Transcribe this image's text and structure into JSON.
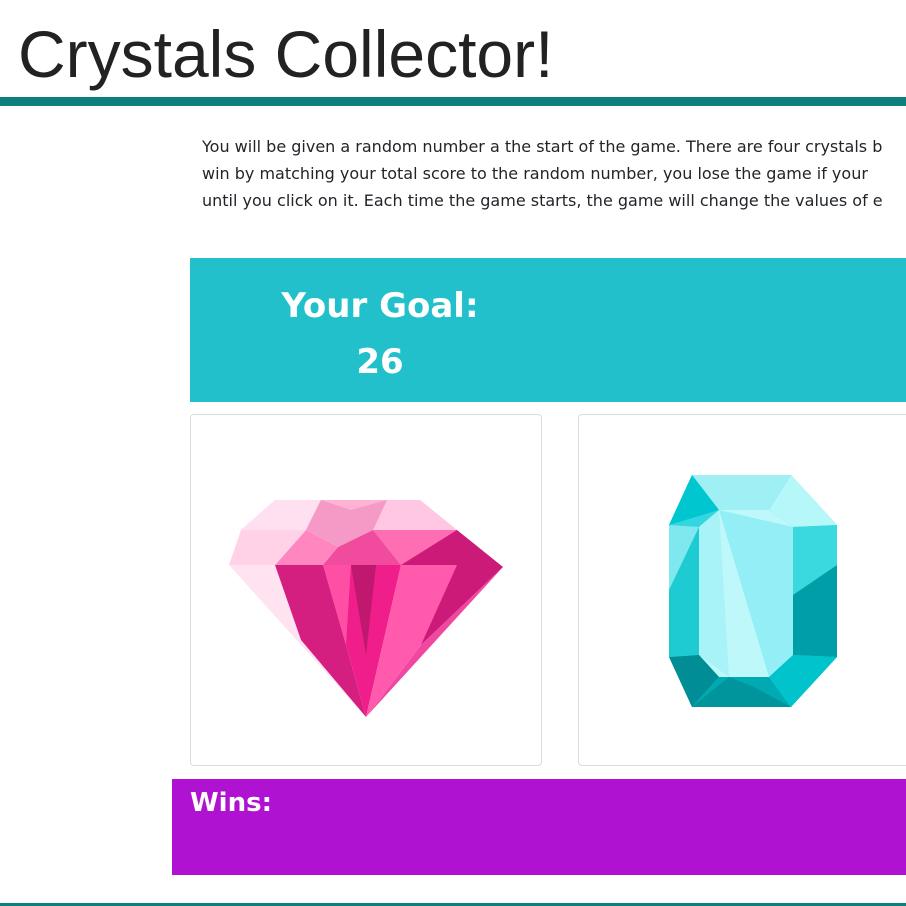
{
  "app": {
    "title": "Crystals Collector!"
  },
  "instructions": {
    "lines": [
      "You will be given a random number a the start of the game. There are four crystals b",
      "win by matching your total score to the random number, you lose the game if your",
      "until you click on it. Each time the game starts, the game will change the values of e"
    ]
  },
  "goal": {
    "label": "Your Goal:",
    "value": "26"
  },
  "crystals": [
    {
      "name": "pink-diamond-crystal",
      "icon": "pink-diamond-icon"
    },
    {
      "name": "blue-gem-crystal",
      "icon": "blue-octagon-gem-icon"
    }
  ],
  "wins": {
    "label": "Wins:"
  },
  "colors": {
    "accent_teal_dark": "#0e7f7c",
    "goal_background": "#21c0cb",
    "wins_background": "#b012d1",
    "pink_crystal": "#e91e8c",
    "blue_crystal": "#00c8d0"
  }
}
